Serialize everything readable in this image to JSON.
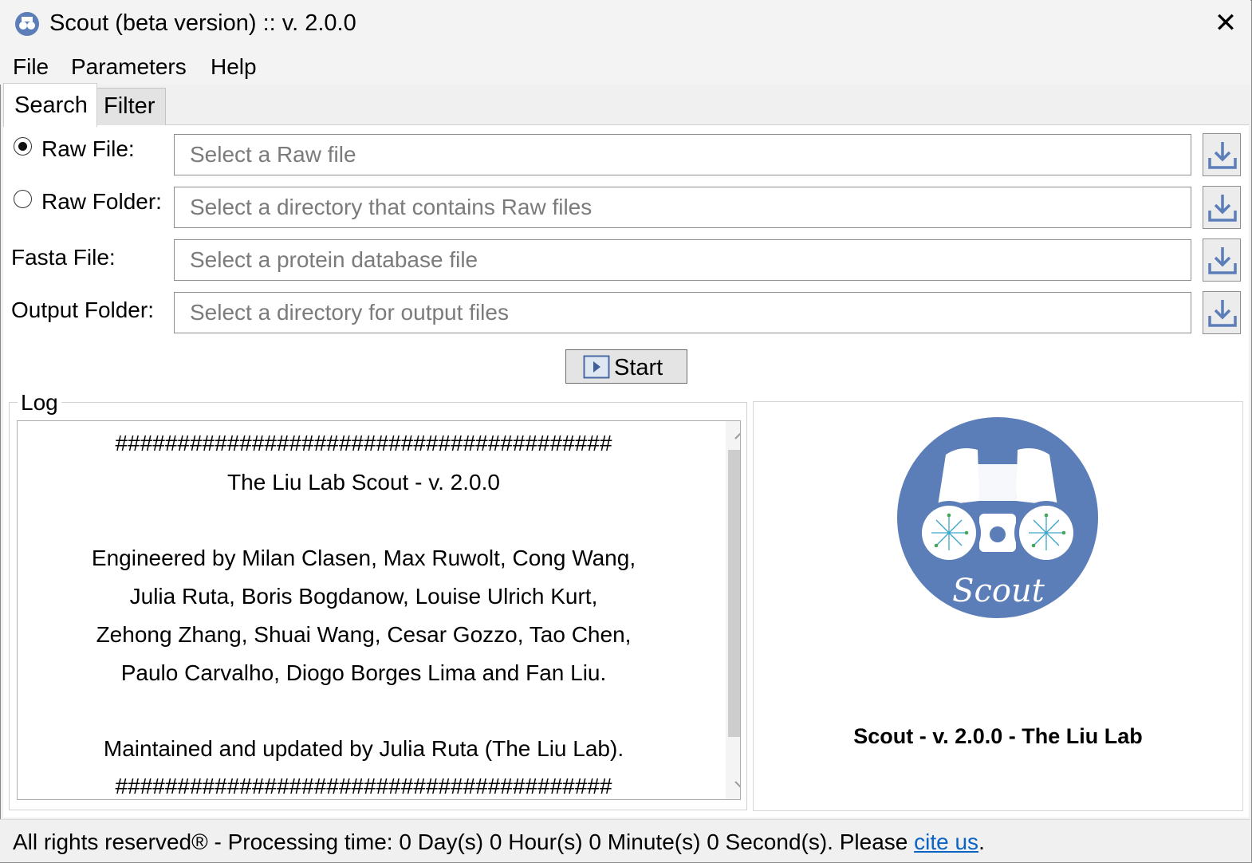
{
  "window": {
    "title": "Scout (beta version) :: v. 2.0.0"
  },
  "menu": {
    "items": [
      "File",
      "Parameters",
      "Help"
    ]
  },
  "tabs": {
    "items": [
      "Search",
      "Filter"
    ],
    "active": "Search"
  },
  "form": {
    "raw_file": {
      "label": "Raw File:",
      "placeholder": "Select a Raw file",
      "selected": true
    },
    "raw_folder": {
      "label": "Raw Folder:",
      "placeholder": "Select a directory that contains Raw files",
      "selected": false
    },
    "fasta_file": {
      "label": "Fasta File:",
      "placeholder": "Select a protein database file"
    },
    "output_folder": {
      "label": "Output Folder:",
      "placeholder": "Select a directory for output files"
    },
    "start_label": "Start"
  },
  "log": {
    "legend": "Log",
    "lines": [
      "########################################",
      "The Liu Lab Scout - v. 2.0.0",
      "",
      "Engineered by Milan Clasen, Max Ruwolt, Cong Wang,",
      "Julia Ruta, Boris Bogdanow, Louise Ulrich Kurt,",
      "Zehong Zhang, Shuai Wang, Cesar Gozzo, Tao Chen,",
      "Paulo Carvalho, Diogo Borges Lima and Fan Liu.",
      "",
      "Maintained and updated by Julia Ruta (The Liu Lab).",
      "########################################"
    ]
  },
  "logo": {
    "text": "Scout",
    "caption": "Scout - v. 2.0.0 - The Liu Lab"
  },
  "status": {
    "text": "All rights reserved® - Processing time: 0 Day(s) 0 Hour(s) 0 Minute(s) 0 Second(s). Please ",
    "link": "cite us",
    "suffix": "."
  },
  "colors": {
    "accent": "#5b7db8",
    "link": "#0b63c4"
  },
  "icons": {
    "download": "download-arrow-icon",
    "start": "play-icon",
    "close": "close-icon"
  }
}
